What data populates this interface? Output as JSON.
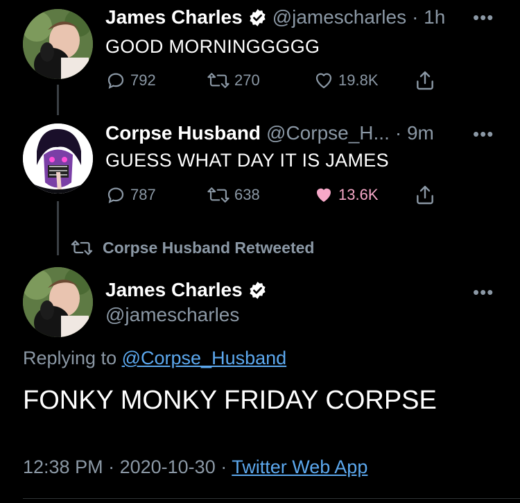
{
  "tweet1": {
    "name": "James Charles",
    "handle": "@jamescharles",
    "time": "· 1h",
    "text": "GOOD MORNINGGGGG",
    "replies": "792",
    "retweets": "270",
    "likes": "19.8K",
    "liked": false
  },
  "tweet2": {
    "name": "Corpse Husband",
    "handle": "@Corpse_H...",
    "time": "· 9m",
    "text": "GUESS WHAT DAY IT IS JAMES",
    "replies": "787",
    "retweets": "638",
    "likes": "13.6K",
    "liked": true
  },
  "retweet_banner": "Corpse Husband Retweeted",
  "main": {
    "name": "James Charles",
    "handle": "@jamescharles",
    "replying_prefix": "Replying to",
    "replying_to": "@Corpse_Husband",
    "text": "FONKY MONKY FRIDAY CORPSE",
    "time": "12:38 PM",
    "date": "2020-10-30",
    "source": "Twitter Web App"
  },
  "more_label": "•••",
  "colors": {
    "background": "#000000",
    "secondary_text": "#8b98a5",
    "link": "#5ca8ee",
    "like_active": "#f7a8c8",
    "verified": "#ffffff"
  },
  "icons": [
    "reply-icon",
    "retweet-icon",
    "like-icon",
    "share-icon",
    "verified-badge-icon",
    "more-icon"
  ]
}
